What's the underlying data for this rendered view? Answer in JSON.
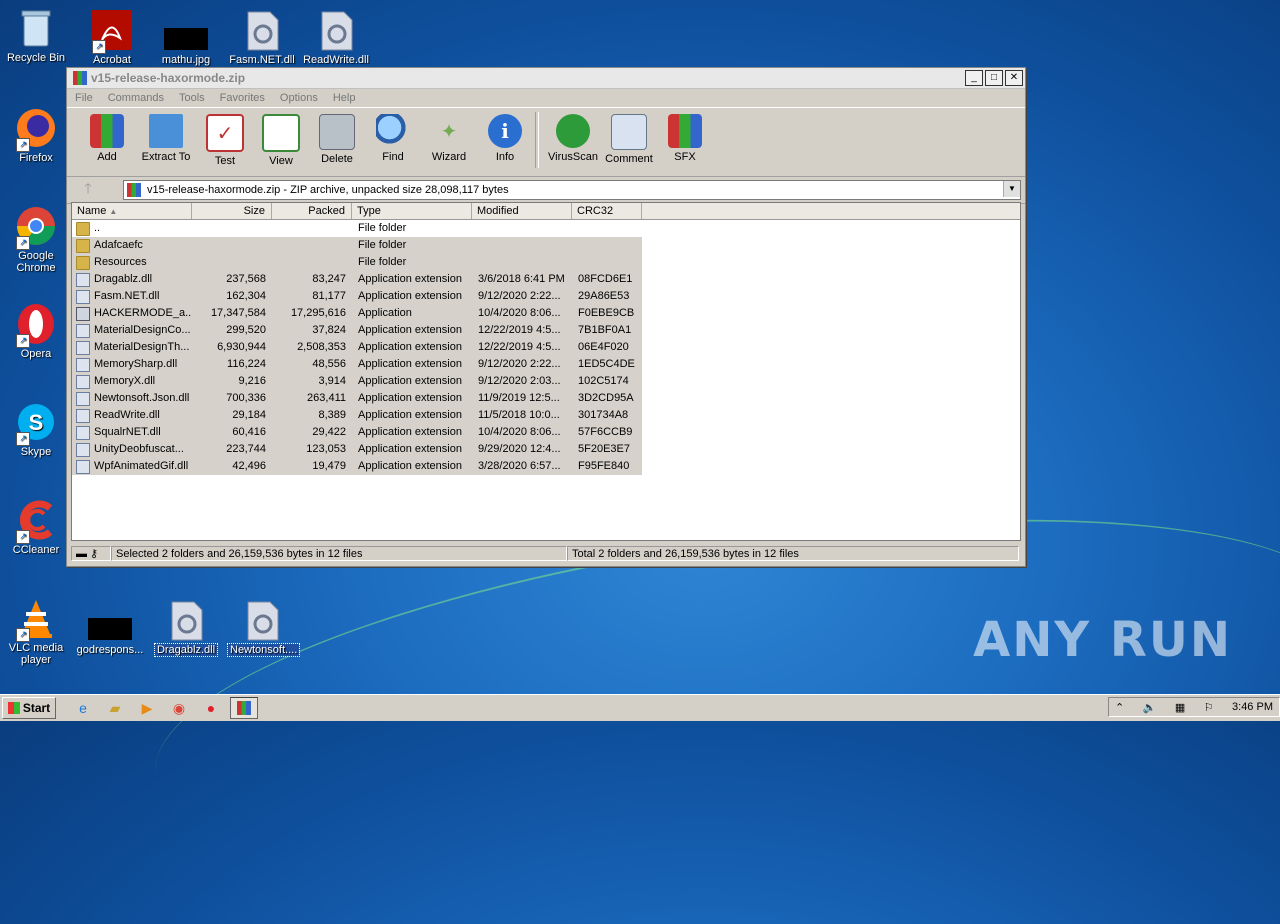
{
  "desktop": {
    "icons_left": [
      {
        "label": "Recycle Bin",
        "icon": "recycle-bin-icon"
      },
      {
        "label": "Firefox",
        "icon": "firefox-icon"
      },
      {
        "label": "Google Chrome",
        "icon": "chrome-icon"
      },
      {
        "label": "Opera",
        "icon": "opera-icon"
      },
      {
        "label": "Skype",
        "icon": "skype-icon"
      },
      {
        "label": "CCleaner",
        "icon": "ccleaner-icon"
      },
      {
        "label": "VLC media player",
        "icon": "vlc-icon"
      }
    ],
    "icons_top": [
      {
        "label": "Acrobat",
        "icon": "acrobat-icon"
      },
      {
        "label": "mathu.jpg",
        "icon": "image-icon"
      },
      {
        "label": "Fasm.NET.dll",
        "icon": "dll-icon"
      },
      {
        "label": "ReadWrite.dll",
        "icon": "dll-icon"
      }
    ],
    "icons_bottom": [
      {
        "label": "godrespons...",
        "icon": "image-icon"
      },
      {
        "label": "Dragablz.dll",
        "icon": "dll-icon"
      },
      {
        "label": "Newtonsoft....",
        "icon": "dll-icon"
      }
    ],
    "watermark": "ANY RUN"
  },
  "window": {
    "title": "v15-release-haxormode.zip",
    "menu": [
      "File",
      "Commands",
      "Tools",
      "Favorites",
      "Options",
      "Help"
    ],
    "toolbar": [
      {
        "label": "Add",
        "icon": "add-archive-icon"
      },
      {
        "label": "Extract To",
        "icon": "extract-folder-icon"
      },
      {
        "label": "Test",
        "icon": "test-clipboard-icon"
      },
      {
        "label": "View",
        "icon": "view-book-icon"
      },
      {
        "label": "Delete",
        "icon": "trash-icon"
      },
      {
        "label": "Find",
        "icon": "magnifier-icon"
      },
      {
        "label": "Wizard",
        "icon": "wand-icon"
      },
      {
        "label": "Info",
        "icon": "info-icon"
      },
      {
        "label": "VirusScan",
        "icon": "bug-icon"
      },
      {
        "label": "Comment",
        "icon": "comment-icon"
      },
      {
        "label": "SFX",
        "icon": "sfx-icon"
      }
    ],
    "address": "v15-release-haxormode.zip - ZIP archive, unpacked size 28,098,117 bytes",
    "columns": [
      "Name",
      "Size",
      "Packed",
      "Type",
      "Modified",
      "CRC32"
    ],
    "rows": [
      {
        "name": "..",
        "size": "",
        "packed": "",
        "type": "File folder",
        "modified": "",
        "crc": "",
        "kind": "folder",
        "selected": false
      },
      {
        "name": "Adafcaefc",
        "size": "",
        "packed": "",
        "type": "File folder",
        "modified": "",
        "crc": "",
        "kind": "folder",
        "selected": true
      },
      {
        "name": "Resources",
        "size": "",
        "packed": "",
        "type": "File folder",
        "modified": "",
        "crc": "",
        "kind": "folder",
        "selected": true
      },
      {
        "name": "Dragablz.dll",
        "size": "237,568",
        "packed": "83,247",
        "type": "Application extension",
        "modified": "3/6/2018 6:41 PM",
        "crc": "08FCD6E1",
        "kind": "dll",
        "selected": true
      },
      {
        "name": "Fasm.NET.dll",
        "size": "162,304",
        "packed": "81,177",
        "type": "Application extension",
        "modified": "9/12/2020 2:22...",
        "crc": "29A86E53",
        "kind": "dll",
        "selected": true
      },
      {
        "name": "HACKERMODE_a...",
        "size": "17,347,584",
        "packed": "17,295,616",
        "type": "Application",
        "modified": "10/4/2020 8:06...",
        "crc": "F0EBE9CB",
        "kind": "exe",
        "selected": true
      },
      {
        "name": "MaterialDesignCo...",
        "size": "299,520",
        "packed": "37,824",
        "type": "Application extension",
        "modified": "12/22/2019 4:5...",
        "crc": "7B1BF0A1",
        "kind": "dll",
        "selected": true
      },
      {
        "name": "MaterialDesignTh...",
        "size": "6,930,944",
        "packed": "2,508,353",
        "type": "Application extension",
        "modified": "12/22/2019 4:5...",
        "crc": "06E4F020",
        "kind": "dll",
        "selected": true
      },
      {
        "name": "MemorySharp.dll",
        "size": "116,224",
        "packed": "48,556",
        "type": "Application extension",
        "modified": "9/12/2020 2:22...",
        "crc": "1ED5C4DE",
        "kind": "dll",
        "selected": true
      },
      {
        "name": "MemoryX.dll",
        "size": "9,216",
        "packed": "3,914",
        "type": "Application extension",
        "modified": "9/12/2020 2:03...",
        "crc": "102C5174",
        "kind": "dll",
        "selected": true
      },
      {
        "name": "Newtonsoft.Json.dll",
        "size": "700,336",
        "packed": "263,411",
        "type": "Application extension",
        "modified": "11/9/2019 12:5...",
        "crc": "3D2CD95A",
        "kind": "dll",
        "selected": true
      },
      {
        "name": "ReadWrite.dll",
        "size": "29,184",
        "packed": "8,389",
        "type": "Application extension",
        "modified": "11/5/2018 10:0...",
        "crc": "301734A8",
        "kind": "dll",
        "selected": true
      },
      {
        "name": "SqualrNET.dll",
        "size": "60,416",
        "packed": "29,422",
        "type": "Application extension",
        "modified": "10/4/2020 8:06...",
        "crc": "57F6CCB9",
        "kind": "dll",
        "selected": true
      },
      {
        "name": "UnityDeobfuscat...",
        "size": "223,744",
        "packed": "123,053",
        "type": "Application extension",
        "modified": "9/29/2020 12:4...",
        "crc": "5F20E3E7",
        "kind": "dll",
        "selected": true
      },
      {
        "name": "WpfAnimatedGif.dll",
        "size": "42,496",
        "packed": "19,479",
        "type": "Application extension",
        "modified": "3/28/2020 6:57...",
        "crc": "F95FE840",
        "kind": "dll",
        "selected": true
      }
    ],
    "status_left": "Selected 2 folders and 26,159,536 bytes in 12 files",
    "status_right": "Total 2 folders and 26,159,536 bytes in 12 files"
  },
  "taskbar": {
    "start": "Start",
    "clock": "3:46 PM"
  }
}
